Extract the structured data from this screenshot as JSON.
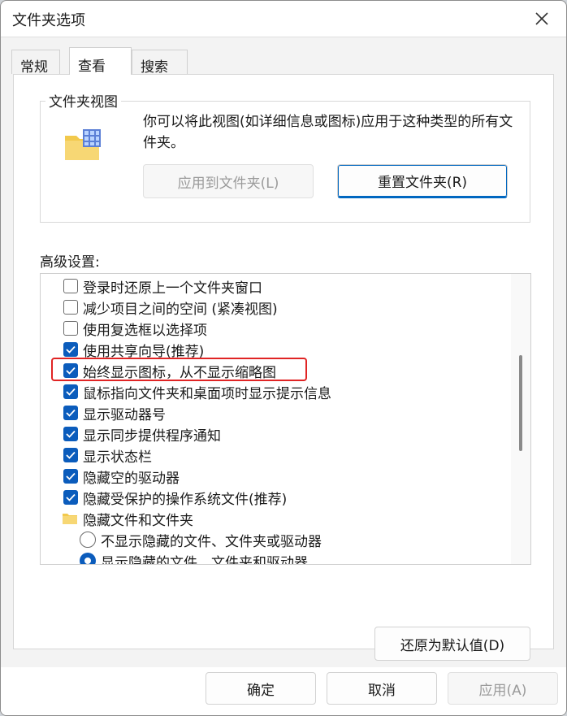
{
  "window": {
    "title": "文件夹选项"
  },
  "tabs": [
    {
      "label": "常规"
    },
    {
      "label": "查看",
      "active": true
    },
    {
      "label": "搜索"
    }
  ],
  "folder_views": {
    "legend": "文件夹视图",
    "description": "你可以将此视图(如详细信息或图标)应用于这种类型的所有文件夹。",
    "apply_button": "应用到文件夹(L)",
    "reset_button": "重置文件夹(R)"
  },
  "advanced": {
    "label": "高级设置:",
    "items": [
      {
        "type": "checkbox",
        "checked": false,
        "label": "登录时还原上一个文件夹窗口"
      },
      {
        "type": "checkbox",
        "checked": false,
        "label": "减少项目之间的空间 (紧凑视图)"
      },
      {
        "type": "checkbox",
        "checked": false,
        "label": "使用复选框以选择项"
      },
      {
        "type": "checkbox",
        "checked": true,
        "label": "使用共享向导(推荐)"
      },
      {
        "type": "checkbox",
        "checked": true,
        "label": "始终显示图标，从不显示缩略图"
      },
      {
        "type": "checkbox",
        "checked": true,
        "label": "鼠标指向文件夹和桌面项时显示提示信息"
      },
      {
        "type": "checkbox",
        "checked": true,
        "label": "显示驱动器号"
      },
      {
        "type": "checkbox",
        "checked": true,
        "label": "显示同步提供程序通知"
      },
      {
        "type": "checkbox",
        "checked": true,
        "label": "显示状态栏"
      },
      {
        "type": "checkbox",
        "checked": true,
        "label": "隐藏空的驱动器"
      },
      {
        "type": "checkbox",
        "checked": true,
        "label": "隐藏受保护的操作系统文件(推荐)"
      },
      {
        "type": "folder",
        "label": "隐藏文件和文件夹"
      },
      {
        "type": "radio",
        "checked": false,
        "label": "不显示隐藏的文件、文件夹或驱动器"
      },
      {
        "type": "radio",
        "checked": true,
        "label": "显示隐藏的文件、文件夹和驱动器"
      }
    ],
    "restore_button": "还原为默认值(D)"
  },
  "footer": {
    "ok": "确定",
    "cancel": "取消",
    "apply": "应用(A)"
  },
  "colors": {
    "accent": "#0b5cbc",
    "highlight": "#e02424"
  }
}
